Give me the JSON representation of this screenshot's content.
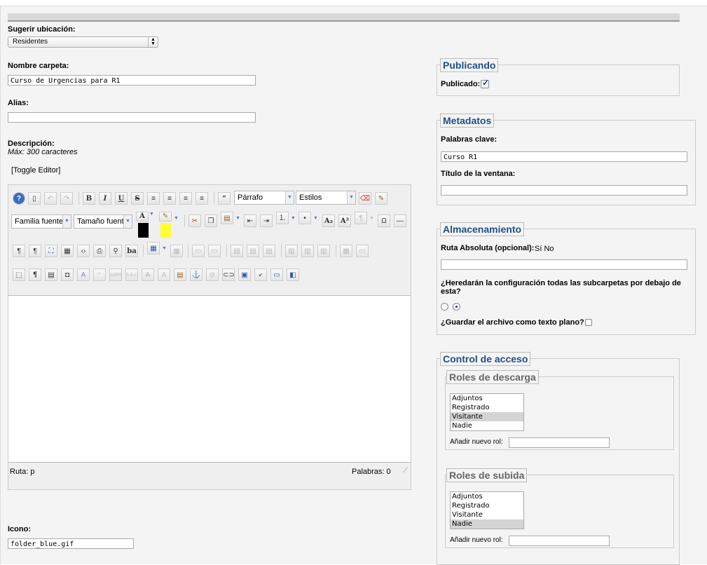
{
  "form": {
    "suggest_location_label": "Sugerir ubicación:",
    "suggest_location_value": "Residentes",
    "folder_name_label": "Nombre carpeta:",
    "folder_name_value": "Curso de Urgencias para R1",
    "alias_label": "Alias:",
    "alias_value": "",
    "description_label": "Descripción:",
    "description_hint": "Máx: 300 caracteres",
    "toggle_editor": "[Toggle Editor]",
    "icon_label": "Icono:",
    "icon_value": "folder_blue.gif"
  },
  "editor": {
    "paragraph_select": "Párrafo",
    "styles_select": "Estilos",
    "font_family_select": "Familia fuente",
    "font_size_select": "Tamaño fuente",
    "path_label": "Ruta:  p",
    "word_count": "Palabras: 0",
    "text_color": "#000000",
    "highlight_color": "#ffff33"
  },
  "publishing": {
    "legend": "Publicando",
    "published_label": "Publicado:",
    "published_checked": true
  },
  "metadata": {
    "legend": "Metadatos",
    "keywords_label": "Palabras clave:",
    "keywords_value": "Curso R1",
    "window_title_label": "Título de la ventana:",
    "window_title_value": ""
  },
  "storage": {
    "legend": "Almacenamiento",
    "absolute_path_label": "Ruta Absoluta (opcional):",
    "absolute_path_options": "Sí No",
    "absolute_path_value": "",
    "inherit_label": "¿Heredarán la configuración todas las subcarpetas por debajo de esta?",
    "inherit_selected": "second",
    "save_plain_label": "¿Guardar el archivo como texto plano?",
    "save_plain_checked": false
  },
  "access": {
    "legend": "Control de acceso",
    "download_roles": {
      "legend": "Roles de descarga",
      "options": [
        "Adjuntos",
        "Registrado",
        "Visitante",
        "Nadie"
      ],
      "selected": "Visitante",
      "add_role_label": "Añadir nuevo rol:"
    },
    "upload_roles": {
      "legend": "Roles de subida",
      "options": [
        "Adjuntos",
        "Registrado",
        "Visitante",
        "Nadie"
      ],
      "selected": "Nadie",
      "add_role_label": "Añadir nuevo rol:"
    }
  },
  "colors": {
    "legend_text": "#1f4f86",
    "panel_bg": "#f4f4f4"
  }
}
